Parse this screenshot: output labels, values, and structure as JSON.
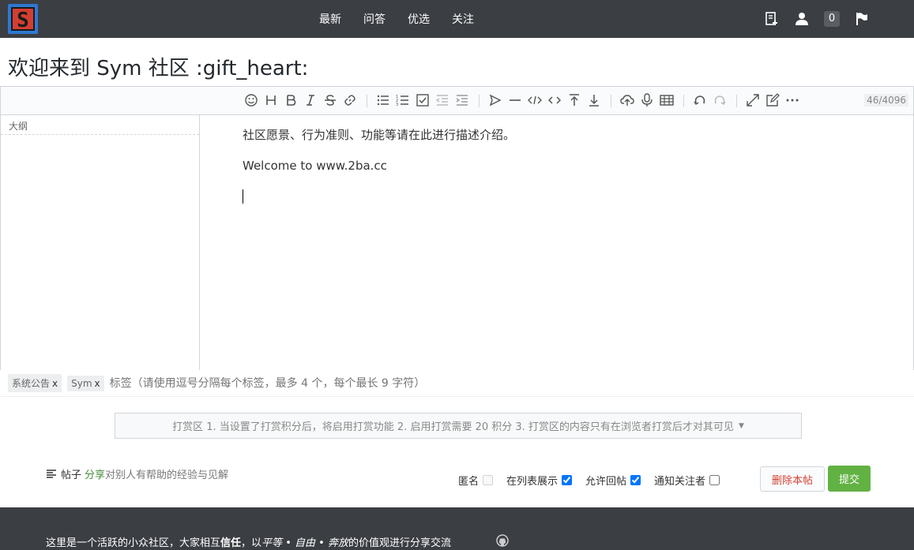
{
  "nav": {
    "links": [
      "最新",
      "问答",
      "优选",
      "关注"
    ],
    "notification_count": "0",
    "icons": [
      "new-post-icon",
      "user-icon",
      "flag-icon"
    ]
  },
  "page_title": "欢迎来到 Sym 社区 :gift_heart:",
  "editor": {
    "counter": "46/4096",
    "outline_label": "大纲",
    "paragraphs": [
      "社区愿景、行为准则、功能等请在此进行描述介绍。",
      "Welcome to www.2ba.cc"
    ]
  },
  "tags": {
    "items": [
      "系统公告",
      "Sym"
    ],
    "remove": "x",
    "placeholder": "标签（请使用逗号分隔每个标签，最多 4 个，每个最长 9 字符）"
  },
  "reward": {
    "text": "打赏区 1. 当设置了打赏积分后，将启用打赏功能 2. 启用打赏需要 20 积分 3. 打赏区的内容只有在浏览者打赏后才对其可见",
    "arrow": "▼"
  },
  "hint": {
    "lead": "帖子",
    "share": "分享",
    "rest": "对别人有帮助的经验与见解"
  },
  "options": {
    "anonymous": "匿名",
    "show_in_list": "在列表展示",
    "allow_reply": "允许回帖",
    "notify_followers": "通知关注者"
  },
  "buttons": {
    "delete": "删除本帖",
    "submit": "提交"
  },
  "footer": {
    "p1": "这里是一个活跃的小众社区，大家相互",
    "trust": "信任",
    "p2": "，以",
    "v1": "平等",
    "dot1": " • ",
    "v2": "自由",
    "dot2": " • ",
    "v3": "奔放",
    "p3": "的价值观进行分享交流"
  },
  "colors": {
    "nav_bg": "#3b3e43",
    "accent_green": "#62b243",
    "danger": "#d23f31"
  }
}
